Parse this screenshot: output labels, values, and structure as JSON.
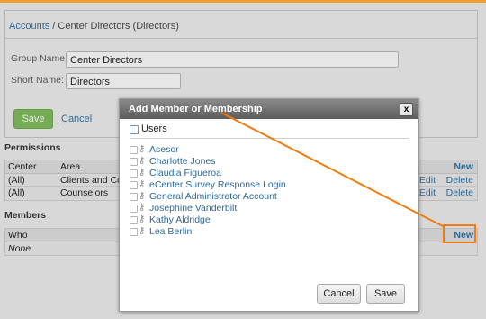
{
  "breadcrumb": {
    "root": "Accounts",
    "separator": " / ",
    "current": "Center Directors (Directors)"
  },
  "form": {
    "group_name_label": "Group Name:",
    "group_name_value": "Center Directors",
    "short_name_label": "Short Name:",
    "short_name_value": "Directors",
    "save_label": "Save",
    "separator": "|",
    "cancel_label": "Cancel"
  },
  "permissions": {
    "title": "Permissions",
    "columns": [
      "Center",
      "Area"
    ],
    "new_label": "New",
    "rows": [
      {
        "center": "(All)",
        "area": "Clients and Co",
        "edit": "Edit",
        "delete": "Delete"
      },
      {
        "center": "(All)",
        "area": "Counselors",
        "edit": "Edit",
        "delete": "Delete"
      }
    ]
  },
  "members": {
    "title": "Members",
    "columns": [
      "Who"
    ],
    "new_label": "New",
    "rows": [
      {
        "who": "None"
      }
    ]
  },
  "modal": {
    "title": "Add Member or Membership",
    "close_label": "x",
    "group_label": "Users",
    "items": [
      "Asesor",
      "Charlotte Jones",
      "Claudia Figueroa",
      "eCenter Survey Response Login",
      "General Administrator Account",
      "Josephine Vanderbilt",
      "Kathy Aldridge",
      "Lea Berlin"
    ],
    "cancel_label": "Cancel",
    "save_label": "Save"
  },
  "colors": {
    "accent": "#f07d10",
    "link": "#2e6a97",
    "save_green": "#5da234"
  },
  "icons": {
    "member_icon": "key-icon",
    "close": "close-icon"
  }
}
